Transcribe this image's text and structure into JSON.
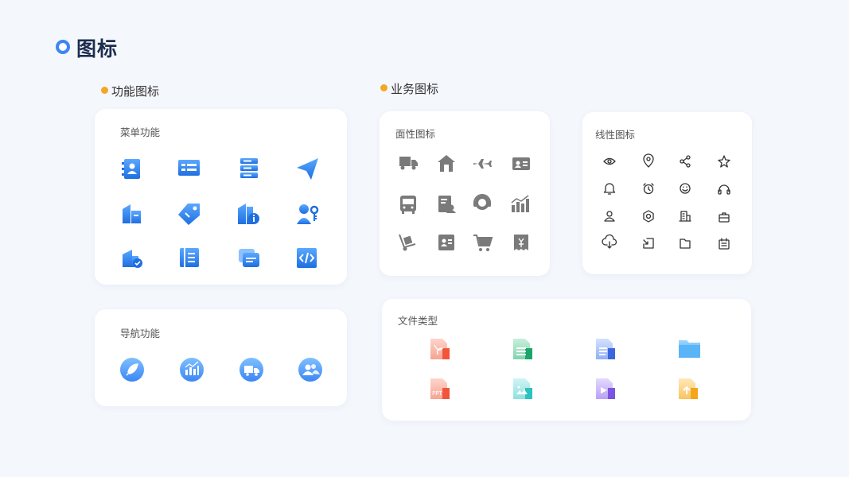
{
  "page": {
    "title": "图标"
  },
  "sections": {
    "functional": {
      "label": "功能图标"
    },
    "business": {
      "label": "业务图标"
    }
  },
  "cards": {
    "menu": {
      "title": "菜单功能",
      "icons": [
        "contact-book-icon",
        "id-card-icon",
        "server-icon",
        "paper-plane-icon",
        "buildings-icon",
        "price-tag-icon",
        "building-info-icon",
        "user-key-icon",
        "building-check-icon",
        "document-list-icon",
        "message-stack-icon",
        "code-icon"
      ]
    },
    "nav": {
      "title": "导航功能",
      "icons": [
        "feather-icon",
        "bar-chart-icon",
        "delivery-truck-icon",
        "users-icon"
      ]
    },
    "solid": {
      "title": "面性图标",
      "icons": [
        "truck-icon",
        "house-icon",
        "airplane-icon",
        "id-card-icon",
        "bus-icon",
        "document-user-icon",
        "customer-service-icon",
        "growth-chart-icon",
        "hand-truck-icon",
        "contact-card-icon",
        "shopping-cart-icon",
        "invoice-icon"
      ]
    },
    "line": {
      "title": "线性图标",
      "icons": [
        "eye-icon",
        "location-pin-icon",
        "share-icon",
        "star-icon",
        "bell-icon",
        "alarm-clock-icon",
        "smile-icon",
        "headphones-icon",
        "user-icon",
        "settings-icon",
        "building-icon",
        "briefcase-icon",
        "cloud-download-icon",
        "import-icon",
        "folder-icon",
        "calendar-note-icon"
      ]
    },
    "files": {
      "title": "文件类型",
      "icons": [
        "pdf-file-icon",
        "sheet-file-icon",
        "word-file-icon",
        "folder-file-icon",
        "ppt-file-icon",
        "image-file-icon",
        "video-file-icon",
        "upload-file-icon"
      ],
      "ppt_text": "PPT"
    }
  },
  "colors": {
    "accent": "#3c86f5",
    "section_dot": "#f5a623",
    "solid_gray": "#7a7a7a",
    "line_dark": "#333333"
  }
}
